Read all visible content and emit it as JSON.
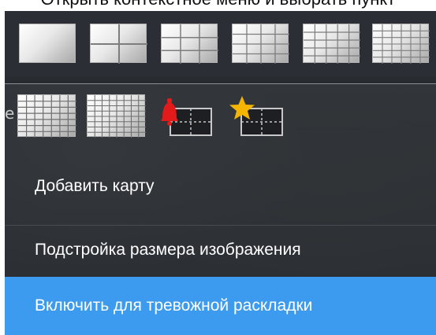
{
  "caption": "Открыть контекстное меню и выбрать пункт",
  "edge_label": "e",
  "menu": {
    "items": [
      {
        "label": "Добавить карту"
      },
      {
        "label": "Подстройка размера изображения"
      },
      {
        "label": "Включить для тревожной раскладки"
      }
    ]
  },
  "layouts": [
    {
      "icon": "layout-1x1-icon"
    },
    {
      "icon": "layout-2x2-icon"
    },
    {
      "icon": "layout-3x3-icon"
    },
    {
      "icon": "layout-4x4-icon"
    },
    {
      "icon": "layout-5x5-icon"
    },
    {
      "icon": "layout-6x6-icon"
    },
    {
      "icon": "layout-7x7-icon"
    },
    {
      "icon": "layout-8x8-icon"
    },
    {
      "icon": "alarm-layout-icon"
    },
    {
      "icon": "favorite-layout-icon"
    }
  ],
  "colors": {
    "accent": "#3d9bef",
    "panel": "#2e3238",
    "alarm_bell": "#e21a1a",
    "star": "#f5b400"
  }
}
